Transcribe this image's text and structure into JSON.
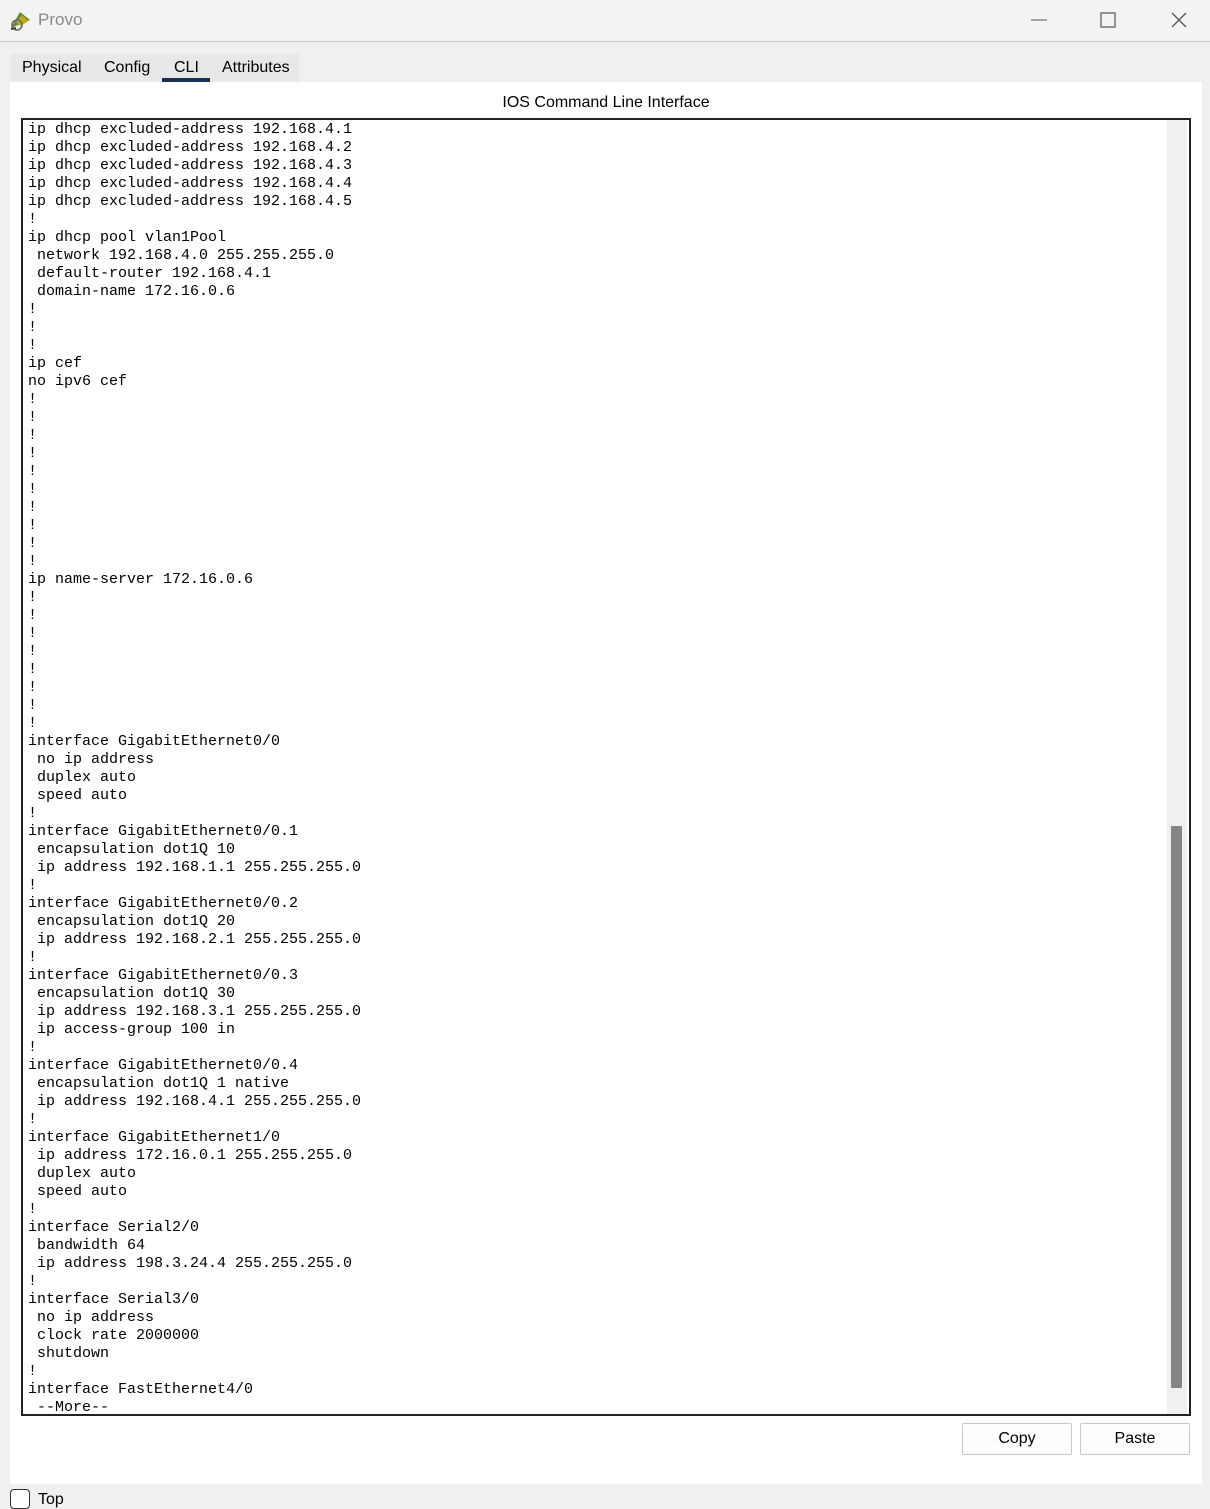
{
  "window": {
    "title": "Provo",
    "icon": "packet-tracer-router-icon",
    "controls": [
      "minimize-icon",
      "maximize-icon",
      "close-icon"
    ]
  },
  "tabs": [
    {
      "label": "Physical"
    },
    {
      "label": "Config"
    },
    {
      "label": "CLI",
      "selected": true
    },
    {
      "label": "Attributes"
    }
  ],
  "panel": {
    "title": "IOS Command Line Interface"
  },
  "console": {
    "lines": [
      "ip dhcp excluded-address 192.168.4.1",
      "ip dhcp excluded-address 192.168.4.2",
      "ip dhcp excluded-address 192.168.4.3",
      "ip dhcp excluded-address 192.168.4.4",
      "ip dhcp excluded-address 192.168.4.5",
      "!",
      "ip dhcp pool vlan1Pool",
      " network 192.168.4.0 255.255.255.0",
      " default-router 192.168.4.1",
      " domain-name 172.16.0.6",
      "!",
      "!",
      "!",
      "ip cef",
      "no ipv6 cef",
      "!",
      "!",
      "!",
      "!",
      "!",
      "!",
      "!",
      "!",
      "!",
      "!",
      "ip name-server 172.16.0.6",
      "!",
      "!",
      "!",
      "!",
      "!",
      "!",
      "!",
      "!",
      "interface GigabitEthernet0/0",
      " no ip address",
      " duplex auto",
      " speed auto",
      "!",
      "interface GigabitEthernet0/0.1",
      " encapsulation dot1Q 10",
      " ip address 192.168.1.1 255.255.255.0",
      "!",
      "interface GigabitEthernet0/0.2",
      " encapsulation dot1Q 20",
      " ip address 192.168.2.1 255.255.255.0",
      "!",
      "interface GigabitEthernet0/0.3",
      " encapsulation dot1Q 30",
      " ip address 192.168.3.1 255.255.255.0",
      " ip access-group 100 in",
      "!",
      "interface GigabitEthernet0/0.4",
      " encapsulation dot1Q 1 native",
      " ip address 192.168.4.1 255.255.255.0",
      "!",
      "interface GigabitEthernet1/0",
      " ip address 172.16.0.1 255.255.255.0",
      " duplex auto",
      " speed auto",
      "!",
      "interface Serial2/0",
      " bandwidth 64",
      " ip address 198.3.24.4 255.255.255.0",
      "!",
      "interface Serial3/0",
      " no ip address",
      " clock rate 2000000",
      " shutdown",
      "!",
      "interface FastEthernet4/0",
      " --More--"
    ]
  },
  "buttons": {
    "copy": "Copy",
    "paste": "Paste"
  },
  "footer": {
    "top_label": "Top",
    "top_checked": false
  }
}
